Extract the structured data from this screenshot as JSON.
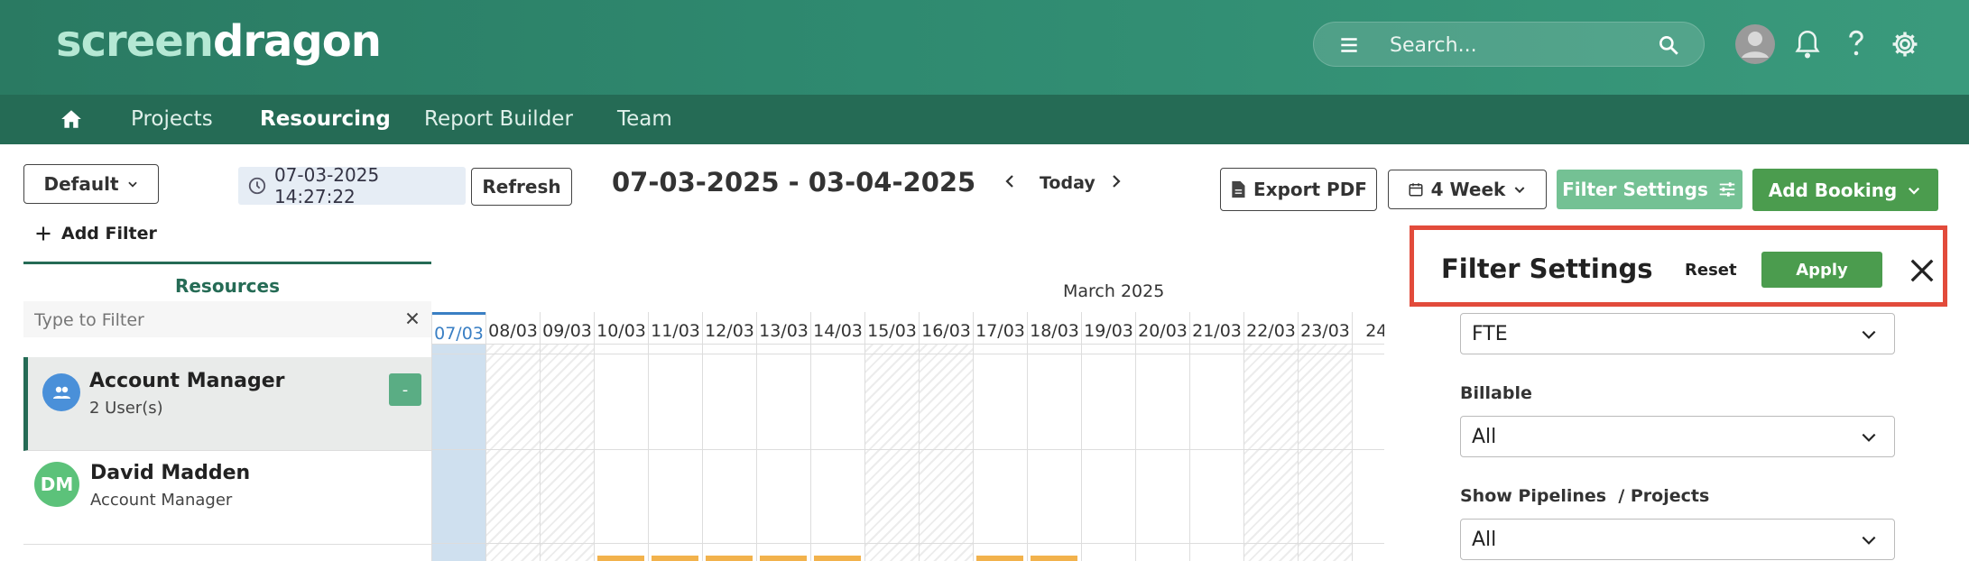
{
  "app": {
    "logo_part1": "screen",
    "logo_part2": "dragon"
  },
  "header": {
    "search_placeholder": "Search..."
  },
  "nav": {
    "items": [
      {
        "label": "Projects"
      },
      {
        "label": "Resourcing",
        "active": true
      },
      {
        "label": "Report Builder"
      },
      {
        "label": "Team"
      }
    ]
  },
  "toolbar": {
    "view_label": "Default",
    "timestamp": "07-03-2025 14:27:22",
    "refresh_label": "Refresh",
    "date_range": "07-03-2025 - 03-04-2025",
    "today_label": "Today",
    "export_label": "Export PDF",
    "period_label": "4 Week",
    "filter_settings_label": "Filter Settings",
    "add_booking_label": "Add Booking",
    "add_filter_label": "Add Filter"
  },
  "resources": {
    "header": "Resources",
    "filter_placeholder": "Type to Filter",
    "group": {
      "name": "Account Manager",
      "count": "2 User(s)",
      "toggle": "-"
    },
    "person": {
      "initials": "DM",
      "name": "David Madden",
      "role": "Account Manager"
    }
  },
  "calendar": {
    "month": "March 2025",
    "days": [
      "07/03",
      "08/03",
      "09/03",
      "10/03",
      "11/03",
      "12/03",
      "13/03",
      "14/03",
      "15/03",
      "16/03",
      "17/03",
      "18/03",
      "19/03",
      "20/03",
      "21/03",
      "22/03",
      "23/03",
      "24/"
    ],
    "weekend_days": [
      "08/03",
      "09/03",
      "15/03",
      "16/03",
      "22/03",
      "23/03"
    ],
    "today": "07/03"
  },
  "filter_panel": {
    "title": "Filter Settings",
    "reset_label": "Reset",
    "apply_label": "Apply",
    "fields": [
      {
        "label": "",
        "value": "FTE"
      },
      {
        "label": "Billable",
        "value": "All"
      },
      {
        "label": "Show Pipelines  / Projects",
        "value": "All"
      }
    ]
  },
  "colors": {
    "brand_green": "#256b55",
    "button_green": "#4b9c4e",
    "highlight_red": "#e24b3b",
    "today_blue": "#3a7fc4",
    "booking_orange": "#f2b24c"
  }
}
